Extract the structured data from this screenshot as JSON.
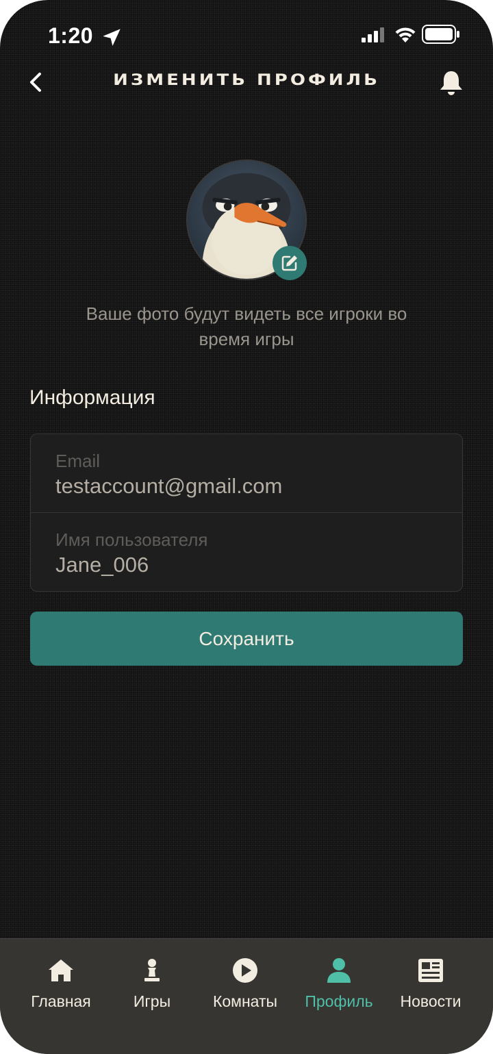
{
  "status_bar": {
    "time": "1:20",
    "icons": [
      "location-arrow-icon",
      "signal-icon",
      "wifi-icon",
      "battery-icon"
    ]
  },
  "header": {
    "title": "ИЗМЕНИТЬ ПРОФИЛЬ",
    "back_icon": "chevron-left-icon",
    "bell_icon": "bell-icon"
  },
  "avatar": {
    "edit_icon": "edit-icon"
  },
  "photo_hint": "Ваше фото будут видеть  все игроки во время игры",
  "info": {
    "title": "Информация",
    "email_label": "Email",
    "email_value": "testaccount@gmail.com",
    "username_label": "Имя пользователя",
    "username_value": "Jane_006"
  },
  "save_label": "Сохранить",
  "nav": {
    "items": [
      {
        "label": "Главная",
        "icon": "home-icon",
        "active": false
      },
      {
        "label": "Игры",
        "icon": "chess-pawn-icon",
        "active": false
      },
      {
        "label": "Комнаты",
        "icon": "play-circle-icon",
        "active": false
      },
      {
        "label": "Профиль",
        "icon": "user-icon",
        "active": true
      },
      {
        "label": "Новости",
        "icon": "newspaper-icon",
        "active": false
      }
    ]
  },
  "colors": {
    "background": "#121212",
    "accent": "#2f7a73",
    "active_nav": "#4fbfa8",
    "nav_background": "#363532",
    "text": "#f3ece0"
  }
}
